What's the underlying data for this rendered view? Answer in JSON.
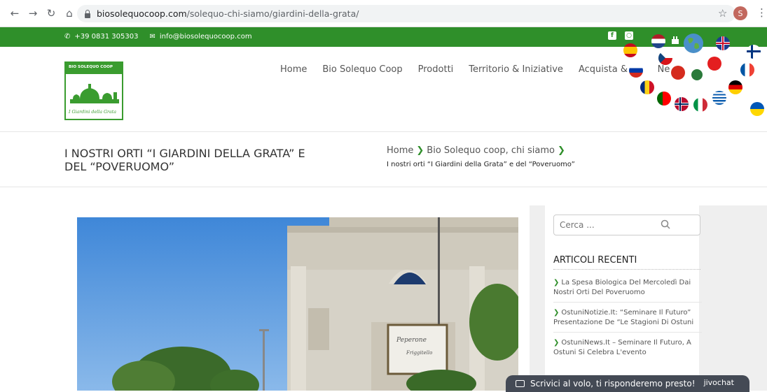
{
  "browser": {
    "url_host": "biosolequocoop.com",
    "url_path": "/solequo-chi-siamo/giardini-della-grata/",
    "profile_initial": "S"
  },
  "topbar": {
    "phone": "+39 0831 305303",
    "email": "info@biosolequocoop.com",
    "bg_color": "#2f8f2a"
  },
  "logo": {
    "band_text": "BIO SOLEQUO COOP",
    "script_text": "I Giardini della Grata"
  },
  "menu": {
    "items": [
      "Home",
      "Bio Solequo Coop",
      "Prodotti",
      "Territorio & Iniziative",
      "Acquista & gu",
      "Ne"
    ]
  },
  "page": {
    "title": "I NOSTRI ORTI “I GIARDINI DELLA GRATA” E DEL “POVERUOMO”",
    "breadcrumb_home": "Home",
    "breadcrumb_section": "Bio Solequo coop, chi siamo",
    "breadcrumb_current": "I nostri orti “I Giardini della Grata” e del “Poveruomo”"
  },
  "sidebar": {
    "search_placeholder": "Cerca ...",
    "recent_title": "ARTICOLI RECENTI",
    "recent_items": [
      "La Spesa Biologica Del Mercoledì Dai Nostri Orti Del Poveruomo",
      "OstuniNotizie.It: “Seminare Il Futuro” Presentazione De “Le Stagioni Di Ostuni",
      "OstuniNews.It – Seminare Il Futuro, A Ostuni Si Celebra L'evento"
    ]
  },
  "chat": {
    "label": "Scrivici al volo, ti risponderemo presto!",
    "brand": "jivochat"
  }
}
